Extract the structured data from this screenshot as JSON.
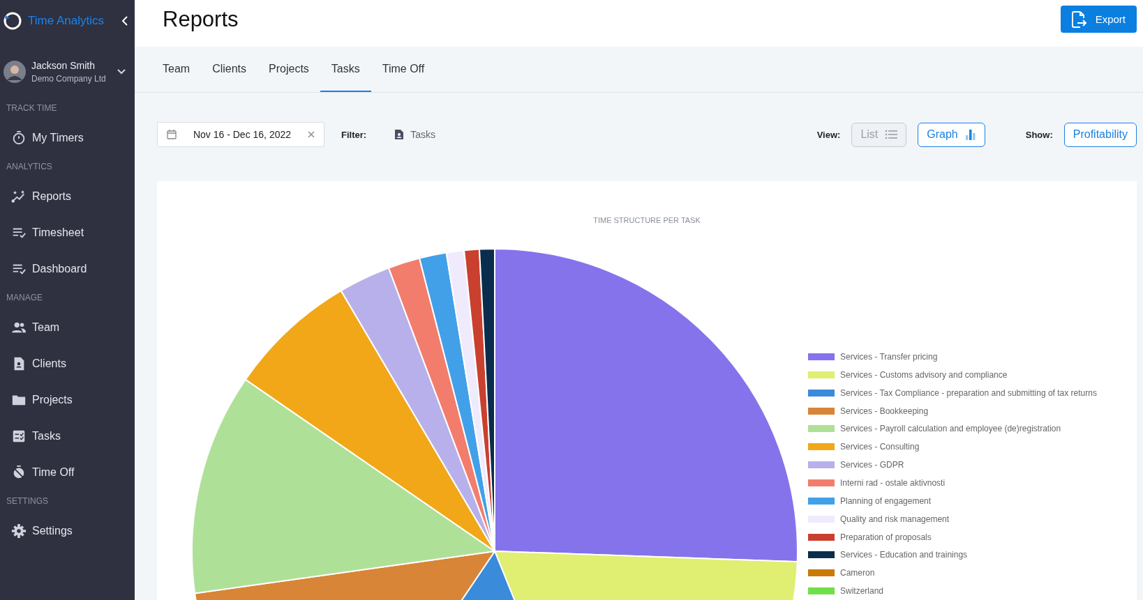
{
  "sidebar": {
    "app_name": "Time Analytics",
    "user": {
      "name": "Jackson Smith",
      "company": "Demo Company Ltd"
    },
    "sections": [
      {
        "title": "TRACK TIME",
        "items": [
          {
            "label": "My Timers",
            "kind": "timer",
            "selected": false
          }
        ]
      },
      {
        "title": "ANALYTICS",
        "items": [
          {
            "label": "Reports",
            "kind": "chart",
            "selected": false
          },
          {
            "label": "Timesheet",
            "kind": "listcheck",
            "selected": false
          },
          {
            "label": "Dashboard",
            "kind": "listdown",
            "selected": false
          }
        ]
      },
      {
        "title": "MANAGE",
        "items": [
          {
            "label": "Team",
            "kind": "people",
            "selected": false
          },
          {
            "label": "Clients",
            "kind": "contact",
            "selected": false
          },
          {
            "label": "Projects",
            "kind": "folder",
            "selected": false
          },
          {
            "label": "Tasks",
            "kind": "tasks",
            "selected": false
          },
          {
            "label": "Time Off",
            "kind": "timeroff",
            "selected": false
          }
        ]
      },
      {
        "title": "SETTINGS",
        "items": [
          {
            "label": "Settings",
            "kind": "gear",
            "selected": false
          }
        ]
      }
    ]
  },
  "header": {
    "title": "Reports",
    "export_button": "Export"
  },
  "tabs": [
    {
      "label": "Team",
      "selected": false
    },
    {
      "label": "Clients",
      "selected": false
    },
    {
      "label": "Projects",
      "selected": false
    },
    {
      "label": "Tasks",
      "selected": true
    },
    {
      "label": "Time Off",
      "selected": false
    }
  ],
  "filters": {
    "date_range": "Nov 16 - Dec 16, 2022",
    "filter_label": "Filter:",
    "filter_value": "Tasks",
    "view_label": "View:",
    "view_options": [
      {
        "label": "List",
        "kind": "list",
        "selected": false
      },
      {
        "label": "Graph",
        "kind": "graph",
        "selected": true
      }
    ],
    "show_label": "Show:",
    "show_button": "Profitability"
  },
  "chart": {
    "title": "TIME STRUCTURE PER TASK",
    "legend": [
      {
        "label": "Services - Transfer pricing",
        "color": "#8573ec"
      },
      {
        "label": "Services - Customs advisory and compliance",
        "color": "#e0ee72"
      },
      {
        "label": "Services - Tax Compliance - preparation and submitting of tax returns",
        "color": "#3a8bda"
      },
      {
        "label": "Services - Bookkeeping",
        "color": "#d98537"
      },
      {
        "label": "Services - Payroll calculation and employee (de)registration",
        "color": "#afe098"
      },
      {
        "label": "Services - Consulting",
        "color": "#f1a718"
      },
      {
        "label": "Services - GDPR",
        "color": "#b8b0ea"
      },
      {
        "label": "Interni rad - ostale aktivnosti",
        "color": "#f27d6c"
      },
      {
        "label": "Planning of engagement",
        "color": "#41a0e8"
      },
      {
        "label": "Quality and risk management",
        "color": "#efebfc"
      },
      {
        "label": "Preparation of proposals",
        "color": "#c9402f"
      },
      {
        "label": "Services - Education and trainings",
        "color": "#0b2d4d"
      },
      {
        "label": "Cameron",
        "color": "#c97a05"
      },
      {
        "label": "Switzerland",
        "color": "#6fe04a"
      }
    ]
  }
}
